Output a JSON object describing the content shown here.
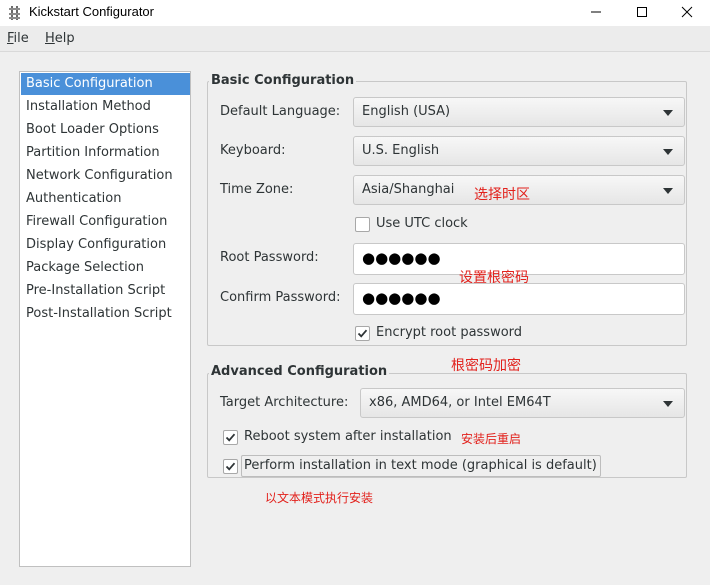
{
  "window": {
    "title": "Kickstart Configurator",
    "icon": "kickstart-app-icon",
    "controls": [
      "minimize-icon",
      "maximize-icon",
      "close-icon"
    ]
  },
  "menubar": {
    "file": {
      "mnemonic": "F",
      "rest": "ile"
    },
    "help": {
      "mnemonic": "H",
      "rest": "elp"
    }
  },
  "sidebar": {
    "selected_index": 0,
    "items": [
      {
        "label": "Basic Configuration"
      },
      {
        "label": "Installation Method"
      },
      {
        "label": "Boot Loader Options"
      },
      {
        "label": "Partition Information"
      },
      {
        "label": "Network Configuration"
      },
      {
        "label": "Authentication"
      },
      {
        "label": "Firewall Configuration"
      },
      {
        "label": "Display Configuration"
      },
      {
        "label": "Package Selection"
      },
      {
        "label": "Pre-Installation Script"
      },
      {
        "label": "Post-Installation Script"
      }
    ]
  },
  "basic": {
    "title": "Basic Configuration",
    "language": {
      "label": "Default Language:",
      "value": "English (USA)"
    },
    "keyboard": {
      "label": "Keyboard:",
      "value": "U.S. English"
    },
    "timezone": {
      "label": "Time Zone:",
      "value": "Asia/Shanghai"
    },
    "utc": {
      "label": "Use UTC clock",
      "checked": false
    },
    "root_password": {
      "label": "Root Password:",
      "value": "●●●●●●"
    },
    "confirm_password": {
      "label": "Confirm Password:",
      "value": "●●●●●●"
    },
    "encrypt": {
      "label": "Encrypt root password",
      "checked": true
    }
  },
  "advanced": {
    "title": "Advanced Configuration",
    "arch": {
      "label": "Target Architecture:",
      "value": "x86, AMD64, or Intel EM64T"
    },
    "reboot": {
      "label": "Reboot system after installation",
      "checked": true
    },
    "textmode": {
      "label": "Perform installation in text mode (graphical is default)",
      "checked": true
    }
  },
  "annotations": {
    "timezone": "选择时区",
    "root_password": "设置根密码",
    "encrypt": "根密码加密",
    "reboot": "安装后重启",
    "textmode": "以文本模式执行安装",
    "color": "#e2211c"
  },
  "colors": {
    "selection": "#4a90d9",
    "background": "#efefef"
  }
}
